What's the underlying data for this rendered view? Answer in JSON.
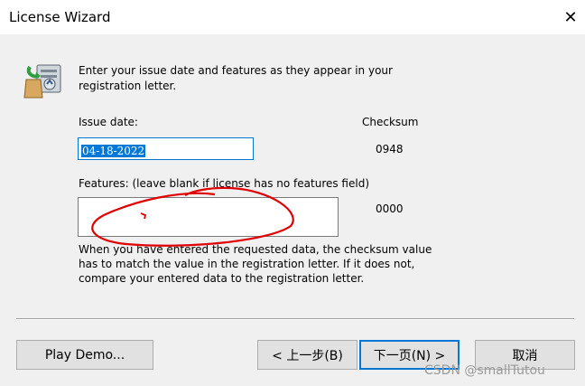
{
  "window": {
    "title": "License Wizard",
    "close_glyph": "✕"
  },
  "icons": {
    "wizard": "license-wizard-icon",
    "close": "close-icon"
  },
  "intro": {
    "text": "Enter your issue date and features as they appear in your registration letter."
  },
  "issue_date": {
    "label": "Issue date:",
    "value": "04-18-2022",
    "checksum": "0948"
  },
  "checksum_header": "Checksum",
  "features": {
    "label": "Features: (leave blank if license has no features field)",
    "value": "",
    "checksum": "0000"
  },
  "note": {
    "text": "When you have entered the requested data, the checksum value has to match the value in the registration letter.  If it does not, compare your entered data to the registration letter."
  },
  "buttons": {
    "play_demo": "Play Demo...",
    "back": "< 上一步(B)",
    "next": "下一页(N) >",
    "cancel": "取消"
  },
  "watermark": "CSDN @smallTutou",
  "colors": {
    "accent": "#0078d7",
    "annotation": "#e00000"
  }
}
